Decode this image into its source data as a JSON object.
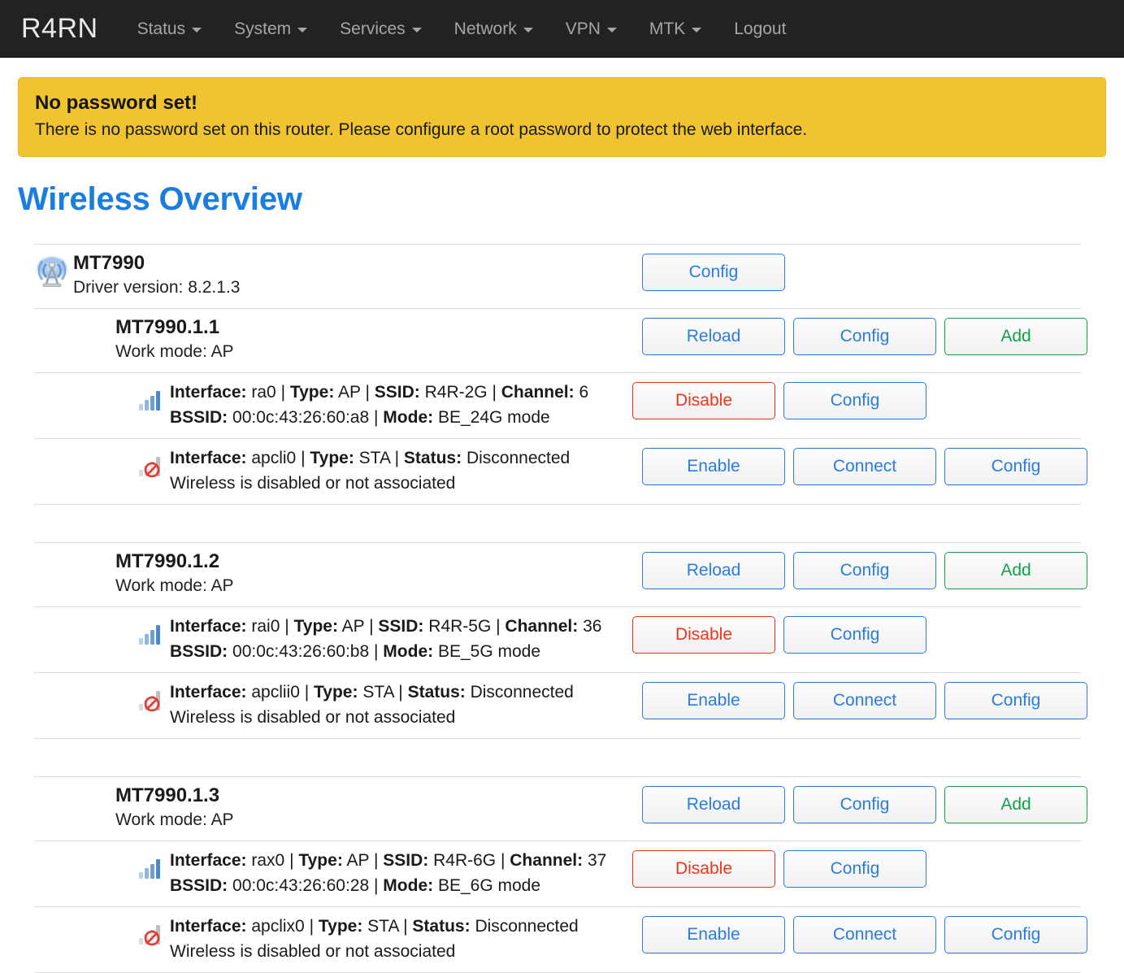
{
  "navbar": {
    "brand": "R4RN",
    "items": [
      {
        "label": "Status",
        "caret": true
      },
      {
        "label": "System",
        "caret": true
      },
      {
        "label": "Services",
        "caret": true
      },
      {
        "label": "Network",
        "caret": true
      },
      {
        "label": "VPN",
        "caret": true
      },
      {
        "label": "MTK",
        "caret": true
      },
      {
        "label": "Logout",
        "caret": false
      }
    ],
    "background": "#222222",
    "text_color": "#a6a6a6"
  },
  "alert": {
    "title": "No password set!",
    "text": "There is no password set on this router. Please configure a root password to protect the web interface.",
    "background": "#f0c330"
  },
  "page": {
    "title": "Wireless Overview",
    "title_color": "#1a7de0"
  },
  "device": {
    "icon": "wireless-antenna-icon",
    "name": "MT7990",
    "driver_label": "Driver version: 8.2.1.3",
    "buttons": [
      {
        "label": "Config",
        "style": "blue",
        "name": "device-config-button"
      }
    ]
  },
  "radios": [
    {
      "name": "MT7990.1.1",
      "work_mode": "Work mode: AP",
      "buttons": [
        {
          "label": "Reload",
          "style": "blue",
          "name": "radio-reload-button"
        },
        {
          "label": "Config",
          "style": "blue",
          "name": "radio-config-button"
        },
        {
          "label": "Add",
          "style": "green",
          "name": "radio-add-button"
        }
      ],
      "interfaces": [
        {
          "icon": "signal-bars-icon",
          "line1": [
            {
              "k": "Interface:",
              "v": " ra0 "
            },
            {
              "sep": "| "
            },
            {
              "k": "Type:",
              "v": " AP "
            },
            {
              "sep": "| "
            },
            {
              "k": "SSID:",
              "v": " R4R-2G "
            },
            {
              "sep": "| "
            },
            {
              "k": "Channel:",
              "v": " 6"
            }
          ],
          "line2": [
            {
              "k": "BSSID:",
              "v": " 00:0c:43:26:60:a8 "
            },
            {
              "sep": "| "
            },
            {
              "k": "Mode:",
              "v": " BE_24G mode"
            }
          ],
          "buttons": [
            {
              "label": "Disable",
              "style": "red",
              "name": "iface-disable-button"
            },
            {
              "label": "Config",
              "style": "blue",
              "name": "iface-config-button"
            }
          ],
          "tight": true
        },
        {
          "icon": "signal-bars-disabled-icon",
          "line1": [
            {
              "k": "Interface:",
              "v": " apcli0 "
            },
            {
              "sep": "| "
            },
            {
              "k": "Type:",
              "v": " STA "
            },
            {
              "sep": "| "
            },
            {
              "k": "Status:",
              "v": " Disconnected"
            }
          ],
          "line2_plain": "Wireless is disabled or not associated",
          "buttons": [
            {
              "label": "Enable",
              "style": "blue",
              "name": "iface-enable-button"
            },
            {
              "label": "Connect",
              "style": "blue",
              "name": "iface-connect-button"
            },
            {
              "label": "Config",
              "style": "blue",
              "name": "iface-config-button"
            }
          ],
          "tight": false
        }
      ]
    },
    {
      "name": "MT7990.1.2",
      "work_mode": "Work mode: AP",
      "buttons": [
        {
          "label": "Reload",
          "style": "blue",
          "name": "radio-reload-button"
        },
        {
          "label": "Config",
          "style": "blue",
          "name": "radio-config-button"
        },
        {
          "label": "Add",
          "style": "green",
          "name": "radio-add-button"
        }
      ],
      "interfaces": [
        {
          "icon": "signal-bars-icon",
          "line1": [
            {
              "k": "Interface:",
              "v": " rai0 "
            },
            {
              "sep": "| "
            },
            {
              "k": "Type:",
              "v": " AP "
            },
            {
              "sep": "| "
            },
            {
              "k": "SSID:",
              "v": " R4R-5G "
            },
            {
              "sep": "| "
            },
            {
              "k": "Channel:",
              "v": " 36"
            }
          ],
          "line2": [
            {
              "k": "BSSID:",
              "v": " 00:0c:43:26:60:b8 "
            },
            {
              "sep": "| "
            },
            {
              "k": "Mode:",
              "v": " BE_5G mode"
            }
          ],
          "buttons": [
            {
              "label": "Disable",
              "style": "red",
              "name": "iface-disable-button"
            },
            {
              "label": "Config",
              "style": "blue",
              "name": "iface-config-button"
            }
          ],
          "tight": true
        },
        {
          "icon": "signal-bars-disabled-icon",
          "line1": [
            {
              "k": "Interface:",
              "v": " apclii0 "
            },
            {
              "sep": "| "
            },
            {
              "k": "Type:",
              "v": " STA "
            },
            {
              "sep": "| "
            },
            {
              "k": "Status:",
              "v": " Disconnected"
            }
          ],
          "line2_plain": "Wireless is disabled or not associated",
          "buttons": [
            {
              "label": "Enable",
              "style": "blue",
              "name": "iface-enable-button"
            },
            {
              "label": "Connect",
              "style": "blue",
              "name": "iface-connect-button"
            },
            {
              "label": "Config",
              "style": "blue",
              "name": "iface-config-button"
            }
          ],
          "tight": false
        }
      ]
    },
    {
      "name": "MT7990.1.3",
      "work_mode": "Work mode: AP",
      "buttons": [
        {
          "label": "Reload",
          "style": "blue",
          "name": "radio-reload-button"
        },
        {
          "label": "Config",
          "style": "blue",
          "name": "radio-config-button"
        },
        {
          "label": "Add",
          "style": "green",
          "name": "radio-add-button"
        }
      ],
      "interfaces": [
        {
          "icon": "signal-bars-icon",
          "line1": [
            {
              "k": "Interface:",
              "v": " rax0 "
            },
            {
              "sep": "| "
            },
            {
              "k": "Type:",
              "v": " AP "
            },
            {
              "sep": "| "
            },
            {
              "k": "SSID:",
              "v": " R4R-6G "
            },
            {
              "sep": "| "
            },
            {
              "k": "Channel:",
              "v": " 37"
            }
          ],
          "line2": [
            {
              "k": "BSSID:",
              "v": " 00:0c:43:26:60:28 "
            },
            {
              "sep": "| "
            },
            {
              "k": "Mode:",
              "v": " BE_6G mode"
            }
          ],
          "buttons": [
            {
              "label": "Disable",
              "style": "red",
              "name": "iface-disable-button"
            },
            {
              "label": "Config",
              "style": "blue",
              "name": "iface-config-button"
            }
          ],
          "tight": true
        },
        {
          "icon": "signal-bars-disabled-icon",
          "line1": [
            {
              "k": "Interface:",
              "v": " apclix0 "
            },
            {
              "sep": "| "
            },
            {
              "k": "Type:",
              "v": " STA "
            },
            {
              "sep": "| "
            },
            {
              "k": "Status:",
              "v": " Disconnected"
            }
          ],
          "line2_plain": "Wireless is disabled or not associated",
          "buttons": [
            {
              "label": "Enable",
              "style": "blue",
              "name": "iface-enable-button"
            },
            {
              "label": "Connect",
              "style": "blue",
              "name": "iface-connect-button"
            },
            {
              "label": "Config",
              "style": "blue",
              "name": "iface-config-button"
            }
          ],
          "tight": false
        }
      ]
    }
  ]
}
